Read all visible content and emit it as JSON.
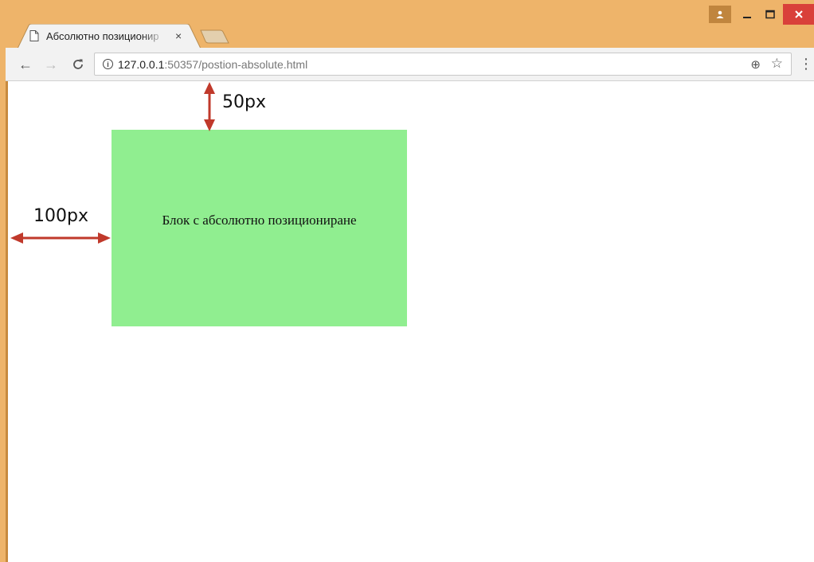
{
  "browser": {
    "tab": {
      "title": "Абсолютно позиционир",
      "close_glyph": "×"
    },
    "window_controls": {
      "profile_glyph": "▲",
      "minimize_glyph": "—",
      "maximize_glyph": "☐",
      "close_glyph": "✕"
    },
    "toolbar": {
      "back_glyph": "←",
      "forward_glyph": "→",
      "reload_glyph": "C",
      "info_glyph": "i",
      "url_host": "127.0.0.1",
      "url_rest": ":50357/postion-absolute.html",
      "zoom_glyph": "⊕",
      "star_glyph": "☆",
      "menu_glyph": "⋮"
    }
  },
  "page": {
    "block_text": "Блок с абсолютно позициониране",
    "block_color": "#90ee90"
  },
  "annotations": {
    "top_offset_label": "50px",
    "left_offset_label": "100px",
    "arrow_color": "#c0392b"
  }
}
